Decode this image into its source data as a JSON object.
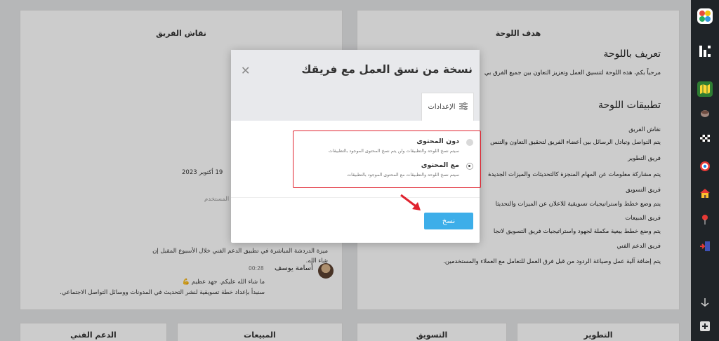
{
  "board_goal": {
    "title": "هدف اللوحة",
    "intro_heading": "تعريف باللوحة",
    "intro_text": "مرحباً بكم، هذه اللوحة لتنسيق العمل وتعزيز التعاون بين جميع الفرق بي",
    "apps_heading": "تطبيقات اللوحة",
    "items": [
      {
        "name": "نقاش الفريق",
        "desc": "يتم التواصل وتبادل الرسائل بين أعضاء الفريق لتحقيق التعاون والتنس"
      },
      {
        "name": "فريق التطوير",
        "desc": "يتم مشاركة معلومات عن المهام المنجزة كالتحديثات والميزات الجديدة"
      },
      {
        "name": "فريق التسويق",
        "desc": "يتم وضع خطط واستراتيجيات تسويقية للاعلان عن الميزات والتحديثا"
      },
      {
        "name": "فريق المبيعات",
        "desc": "يتم وضع خطط بيعية مكملة لجهود واستراتيجيات فريق التسويق لانجا"
      },
      {
        "name": "فريق الدعم الفني",
        "desc": "يتم إضافة آلية عمل وصياغة الردود من قبل فرق العمل للتعامل مع العملاء والمستخدمين."
      }
    ]
  },
  "team_chat": {
    "title": "نقاش الفريق",
    "date": "19 أكتوبر 2023",
    "user_fragment": "المستخدم",
    "msg_line1": "ميزة الدردشة المباشرة في تطبيق الدعم الفني خلال الأسبوع المقبل إن",
    "msg_line2": "شاء الله.",
    "author": "أسامة يوسف",
    "time": "00:28",
    "reply_line1": "ما شاء الله عليكم. جهد عظيم 💪",
    "reply_line2": "سنبدأ بإعداد خطة تسويقية لنشر التحديث في المدونات ووسائل التواصل الاجتماعي."
  },
  "bottom_cards": [
    "الدعم الفني",
    "المبيعات",
    "التسويق",
    "التطوير"
  ],
  "modal": {
    "title": "نسخة من نسق العمل مع فريقك",
    "tab_label": "الإعدادات",
    "option_without_title": "دون المحتوى",
    "option_without_desc": "سيتم نسخ اللوحة والتطبيقات ولن يتم نسخ المحتوى الموجود بالتطبيقات",
    "option_with_title": "مع المحتوى",
    "option_with_desc": "سيتم نسخ اللوحة والتطبيقات مع المحتوى الموجود بالتطبيقات",
    "selected": "with",
    "copy_label": "نسخ"
  },
  "colors": {
    "accent": "#3daee9",
    "highlight": "#e0232f",
    "sidebar": "#1f2428"
  },
  "sidebar_icons": [
    "apps-icon",
    "board-logo-icon",
    "map-icon",
    "coffee-icon",
    "checker-flag-icon",
    "target-icon",
    "house-icon",
    "pin-icon",
    "import-icon",
    "arrow-down-icon",
    "add-icon"
  ]
}
